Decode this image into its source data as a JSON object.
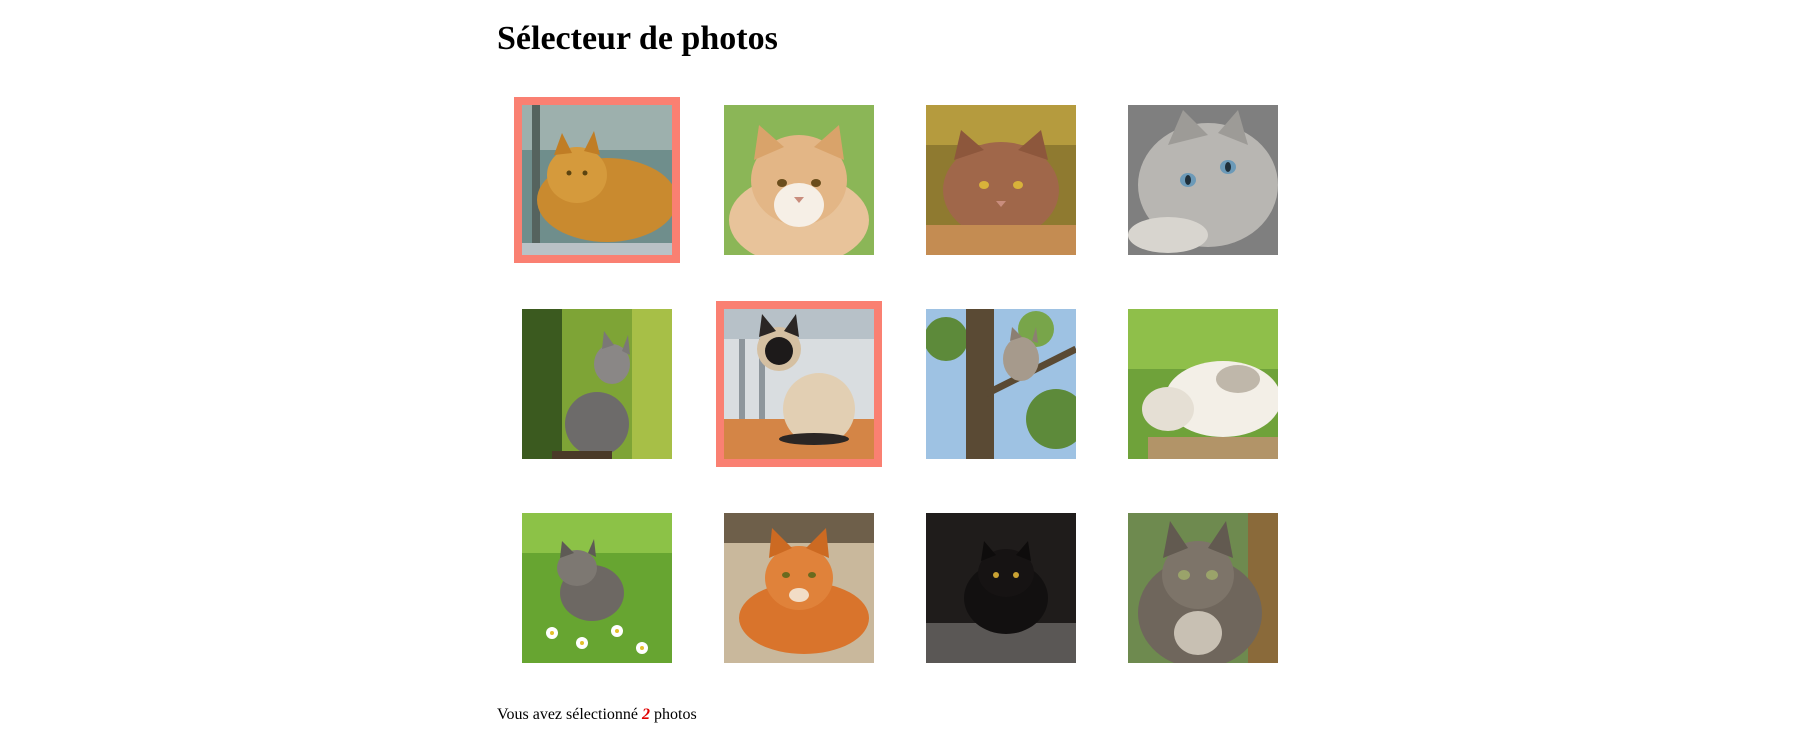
{
  "page": {
    "title": "Sélecteur de photos"
  },
  "selection_color": "#fa8072",
  "photos": [
    {
      "subject": "long-haired orange cat lying",
      "selected": true
    },
    {
      "subject": "fluffy cream and white cat",
      "selected": false
    },
    {
      "subject": "brown tabby cat lying down",
      "selected": false
    },
    {
      "subject": "grey blue-eyed kitten",
      "selected": false
    },
    {
      "subject": "grey kitten looking up in forest",
      "selected": false
    },
    {
      "subject": "siamese cat sitting on table",
      "selected": true
    },
    {
      "subject": "kitten climbing tree",
      "selected": false
    },
    {
      "subject": "white cat rolling on back",
      "selected": false
    },
    {
      "subject": "tabby kitten among daisies",
      "selected": false
    },
    {
      "subject": "orange tabby cat on blanket",
      "selected": false
    },
    {
      "subject": "black cat in the dark",
      "selected": false
    },
    {
      "subject": "grey long-haired cat outdoors",
      "selected": false
    }
  ],
  "status": {
    "prefix": "Vous avez sélectionné ",
    "count": "2",
    "suffix": " photos"
  }
}
